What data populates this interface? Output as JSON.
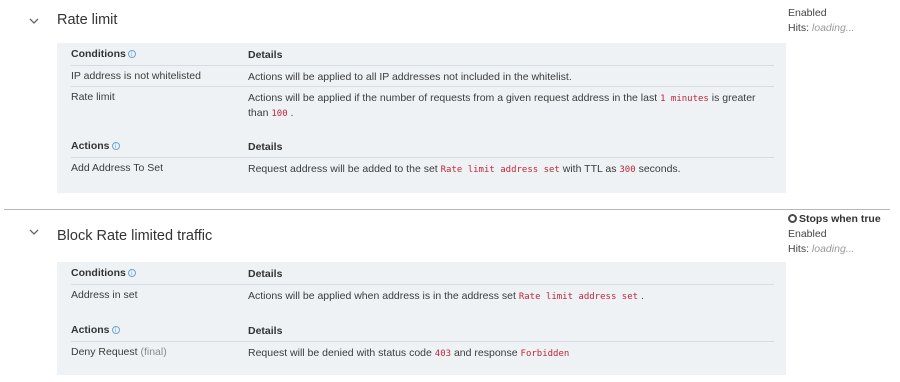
{
  "rules": [
    {
      "title": "Rate limit",
      "status": "Enabled",
      "hits_label": "Hits:",
      "hits_value": "loading...",
      "conditions_header": "Conditions",
      "details_header": "Details",
      "conditions": [
        {
          "name": "IP address is not whitelisted",
          "detail": "Actions will be applied to all IP addresses not included in the whitelist."
        },
        {
          "name": "Rate limit",
          "detail_pre": "Actions will be applied if the number of requests from a given request address in the last",
          "detail_code1": "1 minutes",
          "detail_mid": "is greater than",
          "detail_code2": "100",
          "detail_post": "."
        }
      ],
      "actions_header": "Actions",
      "actions_details_header": "Details",
      "actions": [
        {
          "name": "Add Address To Set",
          "detail_pre": "Request address will be added to the set",
          "detail_code1": "Rate limit address set",
          "detail_mid": "with TTL as",
          "detail_code2": "300",
          "detail_post": "seconds."
        }
      ]
    },
    {
      "title": "Block Rate limited traffic",
      "stops_label": "Stops when true",
      "status": "Enabled",
      "hits_label": "Hits:",
      "hits_value": "loading...",
      "conditions_header": "Conditions",
      "details_header": "Details",
      "conditions": [
        {
          "name": "Address in set",
          "detail_pre": "Actions will be applied when address is in the address set",
          "detail_code1": "Rate limit address set",
          "detail_post": "."
        }
      ],
      "actions_header": "Actions",
      "actions_details_header": "Details",
      "actions": [
        {
          "name": "Deny Request",
          "name_suffix": "(final)",
          "detail_pre": "Request will be denied with status code",
          "detail_code1": "403",
          "detail_mid": "and response",
          "detail_code2": "Forbidden"
        }
      ]
    }
  ],
  "icons": {
    "collapse": "chevron-down-icon",
    "info": "info-icon",
    "stops": "stop-circle-icon"
  },
  "colors": {
    "code": "#c0263b",
    "panel_bg": "#eef2f5",
    "info": "#6aa4d8"
  }
}
